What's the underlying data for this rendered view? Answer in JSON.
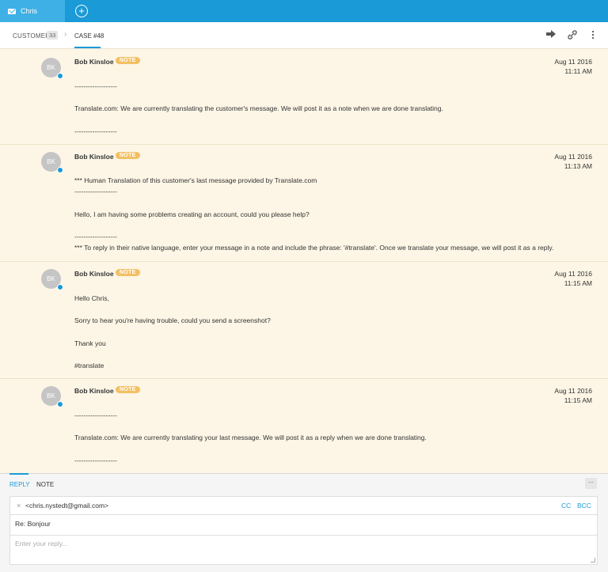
{
  "topbar": {
    "active_tab_label": "Chris",
    "active_tab_icon": "mail-icon",
    "add_tab_icon": "plus-circle-icon",
    "color": "#1a9ad6"
  },
  "header": {
    "breadcrumb_customer": "CUSTOMER",
    "customer_count": "33",
    "breadcrumb_case": "CASE #48",
    "actions": [
      "forward-icon",
      "link-icon",
      "more-vertical-icon"
    ]
  },
  "notes": [
    {
      "avatar": "BK",
      "author": "Bob Kinsloe",
      "badge": "NOTE",
      "date": "Aug 11 2016",
      "time": "11:11 AM",
      "lines": [
        "-------------------",
        "Translate.com: We are currently translating the customer's message. We will post it as a note when we are done translating.",
        "-------------------"
      ]
    },
    {
      "avatar": "BK",
      "author": "Bob Kinsloe",
      "badge": "NOTE",
      "date": "Aug 11 2016",
      "time": "11:13 AM",
      "lines": [
        "*** Human Translation of this customer's last message provided by Translate.com",
        "-------------------",
        "Hello, I am having some problems creating an account, could you please help?",
        "-------------------",
        "*** To reply in their native language, enter your message in a note and include the phrase: '#translate'. Once we translate your message, we will post it as a reply."
      ]
    },
    {
      "avatar": "BK",
      "author": "Bob Kinsloe",
      "badge": "NOTE",
      "date": "Aug 11 2016",
      "time": "11:15 AM",
      "lines": [
        "Hello Chris,",
        "Sorry to hear you're having trouble, could you send a screenshot?",
        "Thank you",
        "#translate"
      ]
    },
    {
      "avatar": "BK",
      "author": "Bob Kinsloe",
      "badge": "NOTE",
      "date": "Aug 11 2016",
      "time": "11:15 AM",
      "lines": [
        "-------------------",
        "Translate.com: We are currently translating your last message. We will post it as a reply when we are done translating.",
        "-------------------"
      ]
    }
  ],
  "composer": {
    "tab_reply": "REPLY",
    "tab_note": "NOTE",
    "minimize_label": "...",
    "to_email": "<chris.nystedt@gmail.com>",
    "cc_label": "CC",
    "bcc_label": "BCC",
    "subject": "Re: Bonjour",
    "body_placeholder": "Enter your reply..."
  }
}
